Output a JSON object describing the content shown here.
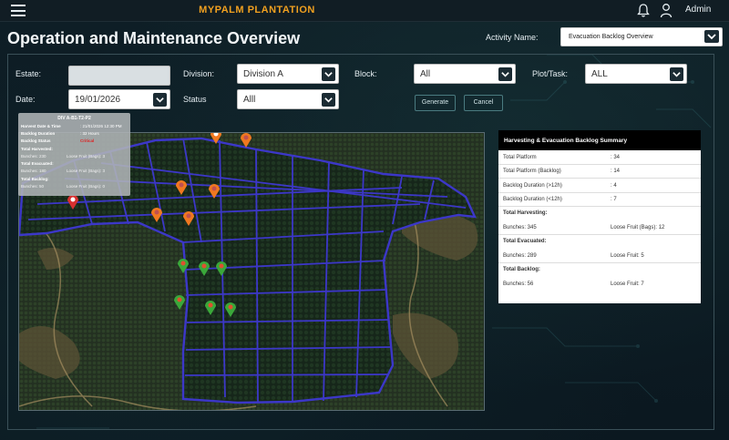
{
  "header": {
    "brand": "MYPALM PLANTATION",
    "user": "Admin",
    "icons": [
      "menu-icon",
      "bell-icon",
      "user-icon"
    ]
  },
  "page": {
    "title": "Operation and Maintenance Overview",
    "activity_label": "Activity Name:",
    "activity_value": "Evacuation Backlog Overview"
  },
  "filters": {
    "estate_label": "Estate:",
    "estate_value": "",
    "division_label": "Division:",
    "division_value": "Division A",
    "block_label": "Block:",
    "block_value": "All",
    "plot_label": "Plot/Task:",
    "plot_value": "ALL",
    "date_label": "Date:",
    "date_value": "19/01/2026",
    "status_label": "Status",
    "status_value": "Alll",
    "generate_label": "Generate",
    "cancel_label": "Cancel"
  },
  "tooltip": {
    "title": "DIV A-B1-T2-P2",
    "harvest_label": "Harvest Date & Time",
    "harvest_value": ": 21/01/2026 12:30 PM",
    "backlog_label": "Backlog Duration",
    "backlog_value": ": 32 Hours",
    "status_label": "Backlog Status",
    "status_value": "Critical",
    "harvested_label": "Total Harvested:",
    "harvested_bunches": "Bunches: 230",
    "harvested_loose": "Loose Fruit (Bags): 3",
    "evacuated_label": "Total Evacuated:",
    "evacuated_bunches": "Bunches: 180",
    "evacuated_loose": "Loose Fruit (Bags): 3",
    "backlog_total_label": "Total Backlog:",
    "backlog_bunches": "Bunches: 50",
    "backlog_loose": "Loose Fruit (Bags): 0"
  },
  "summary": {
    "title": "Harvesting & Evacuation Backlog Summary",
    "rows": [
      {
        "label": "Total Platform",
        "value": ": 34"
      },
      {
        "label": "Total Platform (Backlog)",
        "value": ": 14"
      },
      {
        "label": "Backlog Duration (>12h)",
        "value": ": 4"
      },
      {
        "label": "Backlog Duration (<12h)",
        "value": ": 7"
      }
    ],
    "harvesting_label": "Total Harvesting:",
    "harvesting_bunches": "Bunches: 345",
    "harvesting_loose": "Loose Fruit (Bags): 12",
    "evacuated_label": "Total Evacuated:",
    "evacuated_bunches": "Bunches: 289",
    "evacuated_loose": "Loose Fruit: 5",
    "backlog_label": "Total Backlog:",
    "backlog_bunches": "Bunches: 56",
    "backlog_loose": "Loose Fruit: 7"
  },
  "colors": {
    "brand": "#f0a020",
    "plot_lines": "#3c37c8",
    "marker_orange": "#f07820",
    "marker_green": "#3aa83a",
    "marker_red": "#d83030",
    "critical": "#dd2222"
  }
}
